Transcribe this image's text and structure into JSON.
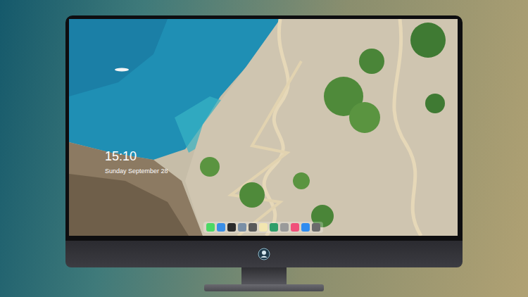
{
  "lock_screen": {
    "time": "15:10",
    "date": "Sunday September 28"
  },
  "dock": {
    "items": [
      {
        "color": "#4cd964"
      },
      {
        "color": "#3a8ee6"
      },
      {
        "color": "#2b2b2b"
      },
      {
        "color": "#7a8fa6"
      },
      {
        "color": "#5a5a5a"
      },
      {
        "color": "#f2e6b0"
      },
      {
        "color": "#2f9e6a"
      },
      {
        "color": "#9a9a9a"
      },
      {
        "color": "#f0507a"
      },
      {
        "color": "#2f8cf0"
      },
      {
        "color": "#6b6b6b"
      }
    ]
  }
}
